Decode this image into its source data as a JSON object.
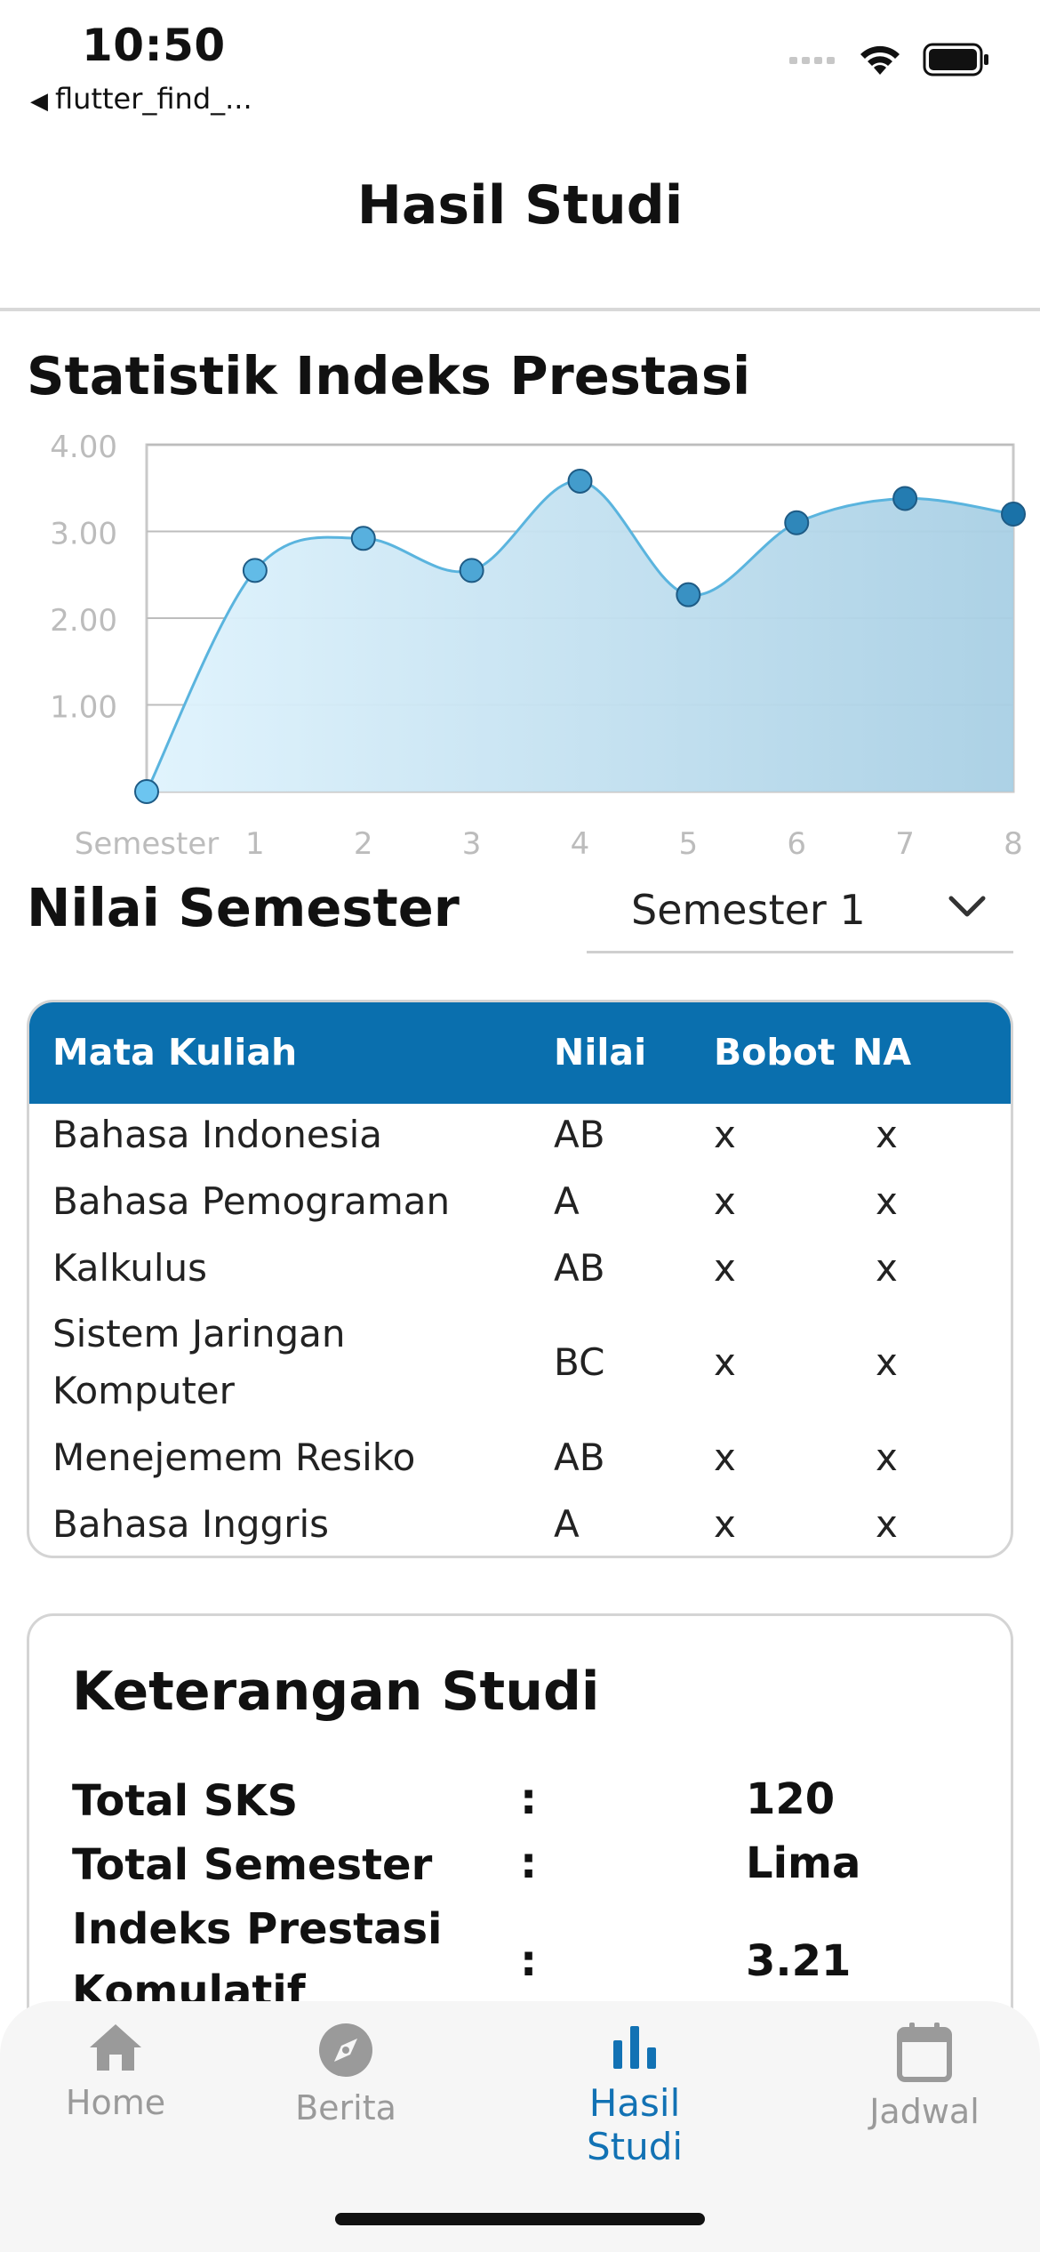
{
  "status_bar": {
    "time": "10:50",
    "back_app": "flutter_find_...",
    "icons": [
      "signal-icon",
      "wifi-icon",
      "battery-icon"
    ]
  },
  "app_bar": {
    "title": "Hasil Studi"
  },
  "chart_section": {
    "title": "Statistik Indeks Prestasi"
  },
  "chart_data": {
    "type": "area",
    "x": [
      "Semester",
      "1",
      "2",
      "3",
      "4",
      "5",
      "6",
      "7",
      "8"
    ],
    "values": [
      0.0,
      2.55,
      2.92,
      2.55,
      3.58,
      2.27,
      3.1,
      3.38,
      3.2
    ],
    "y_ticks": [
      "1.00",
      "2.00",
      "3.00",
      "4.00"
    ],
    "ylim": [
      0,
      4
    ],
    "grid": true,
    "colors": {
      "line": "#5ab4de",
      "fill_start": "#dff3fd",
      "fill_end": "#a8cfe4",
      "point_light": "#6cc5f0",
      "point_dark": "#1a72a8"
    }
  },
  "nilai_section": {
    "title": "Nilai Semester",
    "selected_semester": "Semester 1"
  },
  "table": {
    "headers": [
      "Mata Kuliah",
      "Nilai",
      "Bobot",
      "NA"
    ],
    "rows": [
      {
        "mata_kuliah": "Bahasa Indonesia",
        "nilai": "AB",
        "bobot": "x",
        "na": "x"
      },
      {
        "mata_kuliah": "Bahasa Pemograman",
        "nilai": "A",
        "bobot": "x",
        "na": "x"
      },
      {
        "mata_kuliah": "Kalkulus",
        "nilai": "AB",
        "bobot": "x",
        "na": "x"
      },
      {
        "mata_kuliah_line1": "Sistem Jaringan",
        "mata_kuliah_line2": "Komputer",
        "nilai": "BC",
        "bobot": "x",
        "na": "x"
      },
      {
        "mata_kuliah": "Menejemem Resiko",
        "nilai": "AB",
        "bobot": "x",
        "na": "x"
      },
      {
        "mata_kuliah": "Bahasa Inggris",
        "nilai": "A",
        "bobot": "x",
        "na": "x"
      }
    ]
  },
  "keterangan": {
    "title": "Keterangan Studi",
    "colon": ":",
    "rows": [
      {
        "label": "Total SKS",
        "value": "120"
      },
      {
        "label": "Total Semester",
        "value": "Lima"
      },
      {
        "label_line1": "Indeks Prestasi",
        "label_line2": "Komulatif",
        "value": "3.21"
      }
    ]
  },
  "bottom_nav": {
    "items": [
      {
        "label": "Home",
        "icon": "home-icon"
      },
      {
        "label": "Berita",
        "icon": "compass-icon"
      },
      {
        "label": "Hasil Studi",
        "icon": "bar-chart-icon",
        "active": true
      },
      {
        "label": "Jadwal",
        "icon": "calendar-icon"
      }
    ],
    "active_color": "#1272b4"
  }
}
